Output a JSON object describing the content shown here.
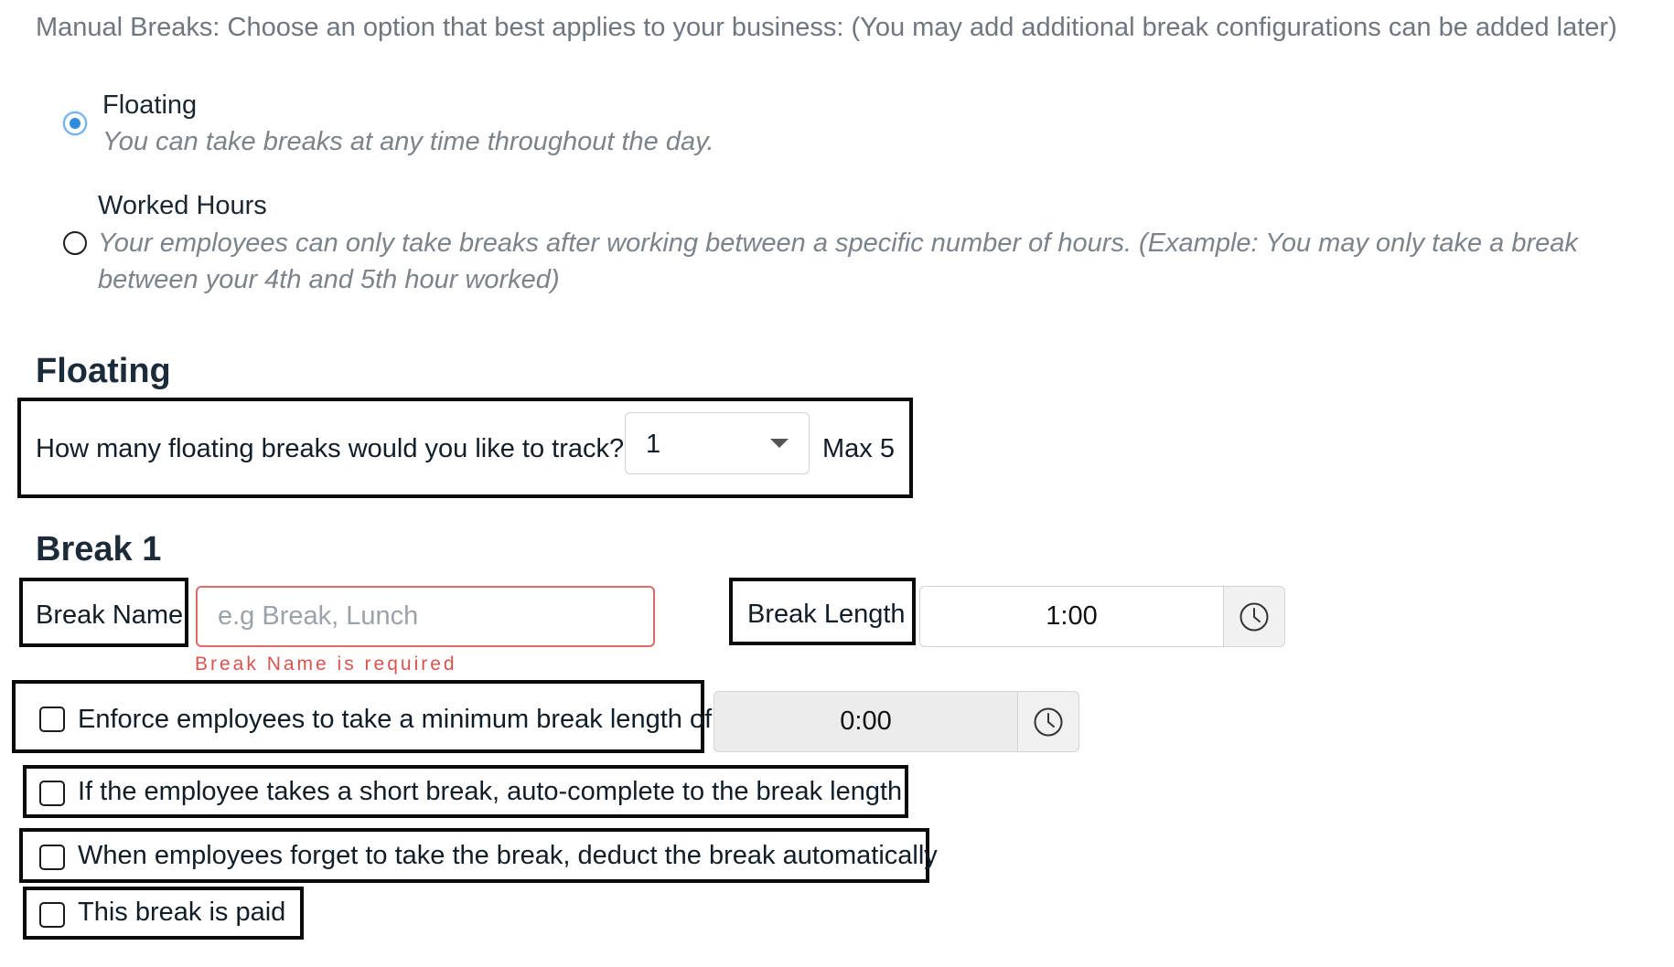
{
  "intro_text": "Manual Breaks: Choose an option that best applies to your business: (You may add additional break configurations can be added later)",
  "options": [
    {
      "title": "Floating",
      "description": "You can take breaks at any time throughout the day.",
      "selected": true
    },
    {
      "title": "Worked Hours",
      "description": "Your employees can only take breaks after working between a specific number of hours. (Example: You may only take a break between your 4th and 5th hour worked)",
      "selected": false
    }
  ],
  "floating_section": {
    "heading": "Floating",
    "question": "How many floating breaks would you like to track?",
    "count_value": "1",
    "max_label": "Max 5"
  },
  "break_section": {
    "heading": "Break 1",
    "name_label": "Break Name",
    "name_placeholder": "e.g Break, Lunch",
    "name_value": "",
    "name_error": "Break Name is required",
    "length_label": "Break Length",
    "length_value": "1:00",
    "min_length_value": "0:00",
    "checkboxes": [
      {
        "label": "Enforce employees to take a minimum break length of",
        "checked": false
      },
      {
        "label": "If the employee takes a short break, auto-complete to the break length",
        "checked": false
      },
      {
        "label": "When employees forget to take the break, deduct the break automatically",
        "checked": false
      },
      {
        "label": "This break is paid",
        "checked": false
      }
    ]
  },
  "colors": {
    "accent": "#2f8ae0",
    "error": "#d9534f",
    "annotation_border": "#0a0a0a"
  },
  "icons": {
    "time_picker": "clock-icon",
    "select": "chevron-down-icon"
  }
}
